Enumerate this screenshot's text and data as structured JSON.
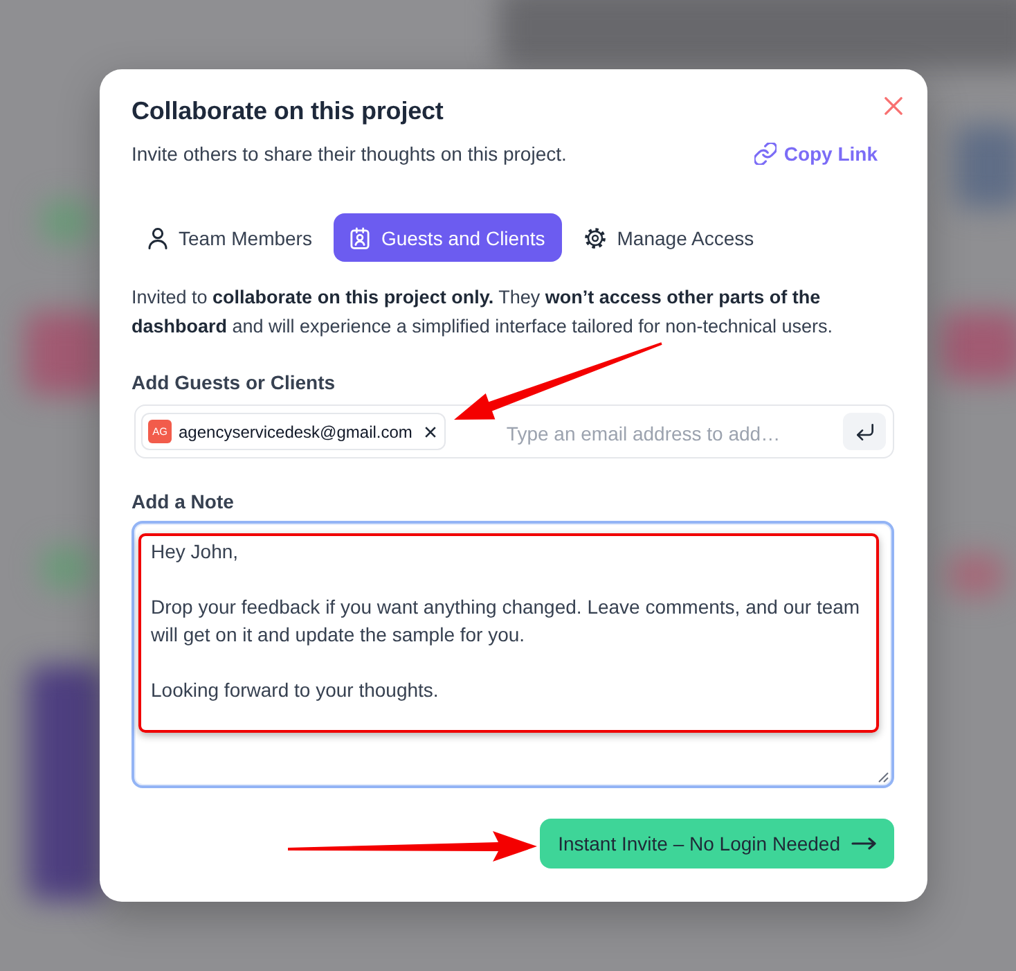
{
  "dialog": {
    "title": "Collaborate on this project",
    "subtitle": "Invite others to share their thoughts on this project.",
    "copy_link": "Copy Link"
  },
  "tabs": [
    {
      "label": "Team Members",
      "selected": false
    },
    {
      "label": "Guests and Clients",
      "selected": true
    },
    {
      "label": "Manage Access",
      "selected": false
    }
  ],
  "description": "Invited to **collaborate on this project only.** They **won’t access other parts of the dashboard** and will experience a simplified interface tailored for non-technical users.",
  "guests": {
    "label": "Add Guests or Clients",
    "chips": [
      {
        "initials": "AG",
        "email": "agencyservicedesk@gmail.com"
      }
    ],
    "placeholder": "Type an email address to add…",
    "annotated": true
  },
  "note": {
    "label": "Add a Note",
    "value": "Hey John,\n\nDrop your feedback if you want anything changed. Leave comments, and our team will get on it and update the sample for you.\n\nLooking forward to your thoughts.",
    "focused": true,
    "annotated": true
  },
  "invite_button": {
    "label": "Instant Invite – No Login Needed",
    "annotated": true
  }
}
